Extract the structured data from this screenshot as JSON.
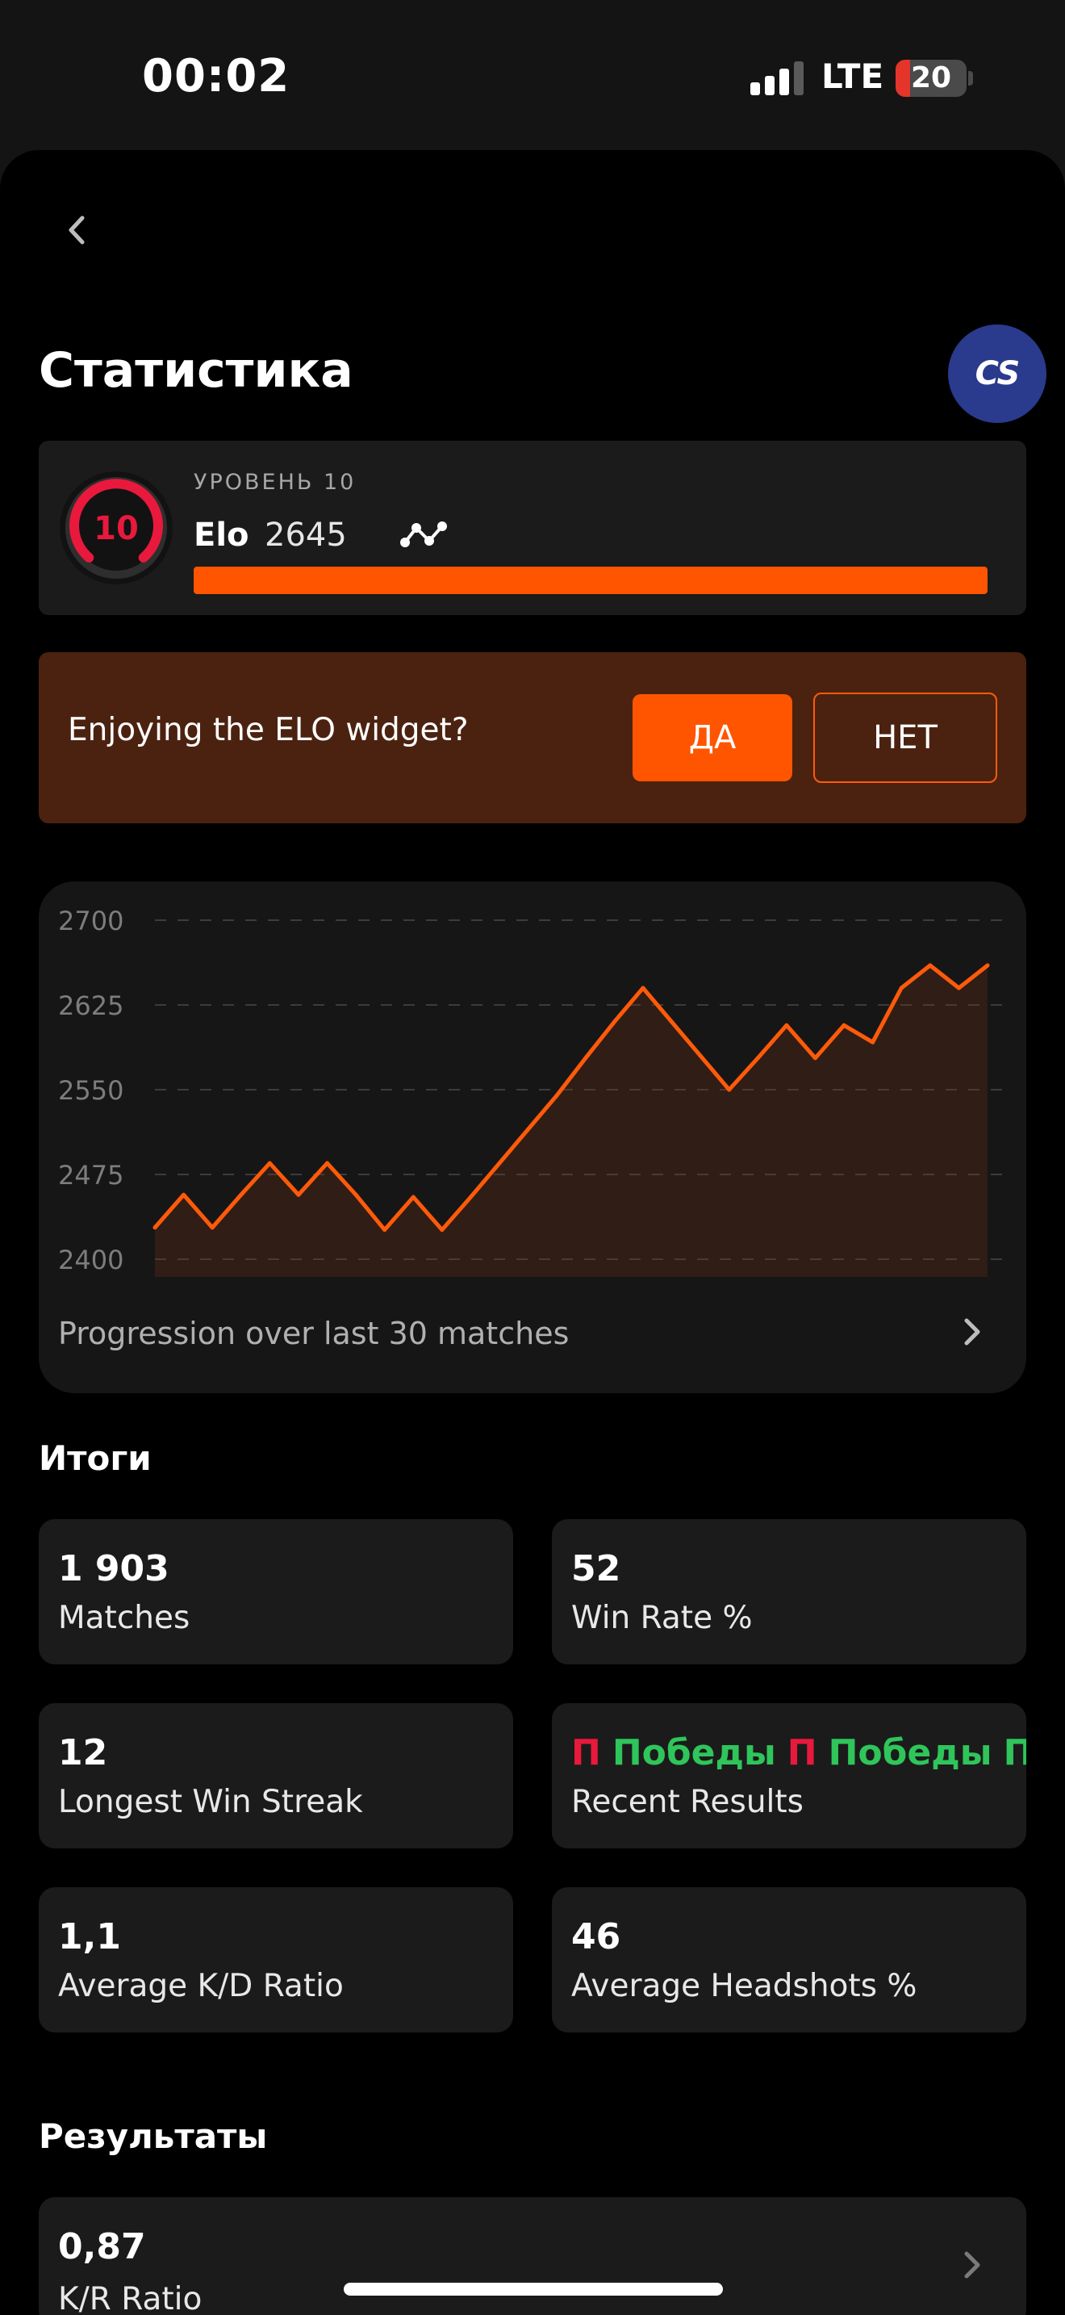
{
  "status_bar": {
    "time": "00:02",
    "network": "LTE",
    "battery": "20",
    "battery_level": 0.2
  },
  "header": {
    "title": "Статистика",
    "game_badge": "CS"
  },
  "level_card": {
    "level_label": "УРОВЕНЬ 10",
    "level_number": "10",
    "elo_label": "Elo",
    "elo_value": "2645",
    "progress_fraction": 1.0,
    "accent_color": "#ff5500",
    "ring_color": "#e8193c"
  },
  "prompt": {
    "text": "Enjoying the ELO widget?",
    "yes_label": "ДА",
    "no_label": "НЕТ"
  },
  "chart": {
    "caption": "Progression over last 30 matches",
    "chart_data": {
      "type": "area",
      "y_ticks": [
        "2700",
        "2625",
        "2550",
        "2475",
        "2400"
      ],
      "ylim": [
        2400,
        2700
      ],
      "grid": true,
      "line_color": "#ff5a0a",
      "x": [
        1,
        2,
        3,
        4,
        5,
        6,
        7,
        8,
        9,
        10,
        11,
        12,
        13,
        14,
        15,
        16,
        17,
        18,
        19,
        20,
        21,
        22,
        23,
        24,
        25,
        26,
        27,
        28,
        29,
        30
      ],
      "values": [
        2428,
        2457,
        2428,
        2457,
        2485,
        2457,
        2485,
        2457,
        2426,
        2455,
        2426,
        2455,
        2485,
        2515,
        2545,
        2578,
        2610,
        2640,
        2610,
        2580,
        2550,
        2578,
        2607,
        2578,
        2607,
        2592,
        2640,
        2660,
        2640,
        2660
      ]
    }
  },
  "totals": {
    "title": "Итоги",
    "matches": {
      "value": "1 903",
      "label": "Matches"
    },
    "win_rate": {
      "value": "52",
      "label": "Win Rate %"
    },
    "streak": {
      "value": "12",
      "label": "Longest Win Streak"
    },
    "recent": {
      "label": "Recent Results",
      "items": [
        {
          "text": "П",
          "kind": "loss"
        },
        {
          "text": "Победы",
          "kind": "win"
        },
        {
          "text": "П",
          "kind": "loss"
        },
        {
          "text": "Победы",
          "kind": "win"
        },
        {
          "text": "Поб",
          "kind": "win"
        }
      ],
      "loss_color": "#e8193c",
      "win_color": "#2fc55a"
    },
    "kd": {
      "value": "1,1",
      "label": "Average K/D Ratio"
    },
    "headshots": {
      "value": "46",
      "label": "Average Headshots %"
    }
  },
  "results": {
    "title": "Результаты",
    "kr": {
      "value": "0,87",
      "label": "K/R Ratio"
    }
  }
}
